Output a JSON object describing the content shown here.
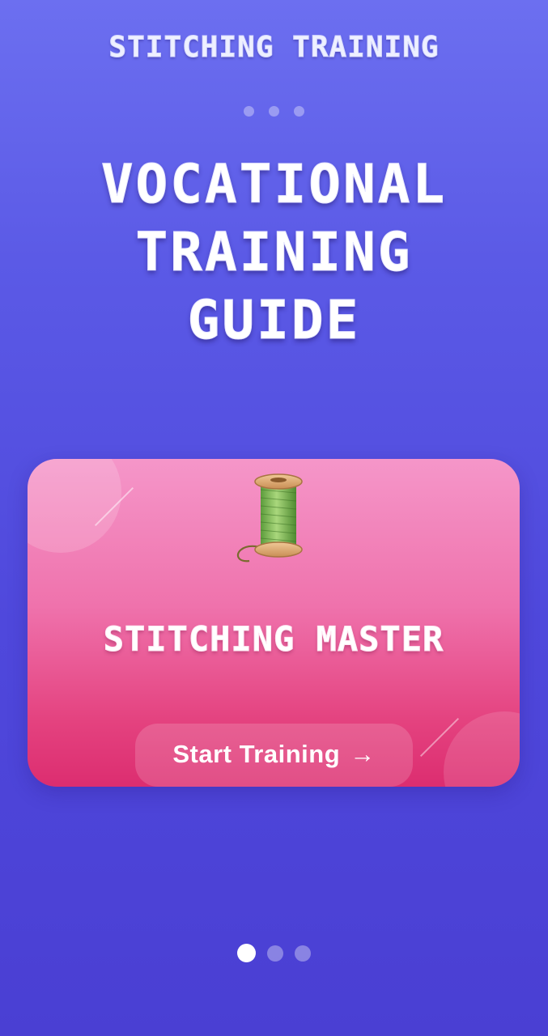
{
  "header": {
    "app_title": "STITCHING TRAINING"
  },
  "hero": {
    "title_lines": [
      "VOCATIONAL",
      "TRAINING",
      "GUIDE"
    ]
  },
  "card": {
    "icon": "thread-spool-icon",
    "title": "STITCHING MASTER",
    "button_label": "Start Training",
    "button_arrow": "→",
    "colors": {
      "top": "#f596c9",
      "bottom": "#dc2d70"
    }
  },
  "pager": {
    "total": 3,
    "active_index": 0
  },
  "top_indicator": {
    "total": 3
  },
  "colors": {
    "background_top": "#6c6ff0",
    "background_bottom": "#4a3fd3"
  }
}
